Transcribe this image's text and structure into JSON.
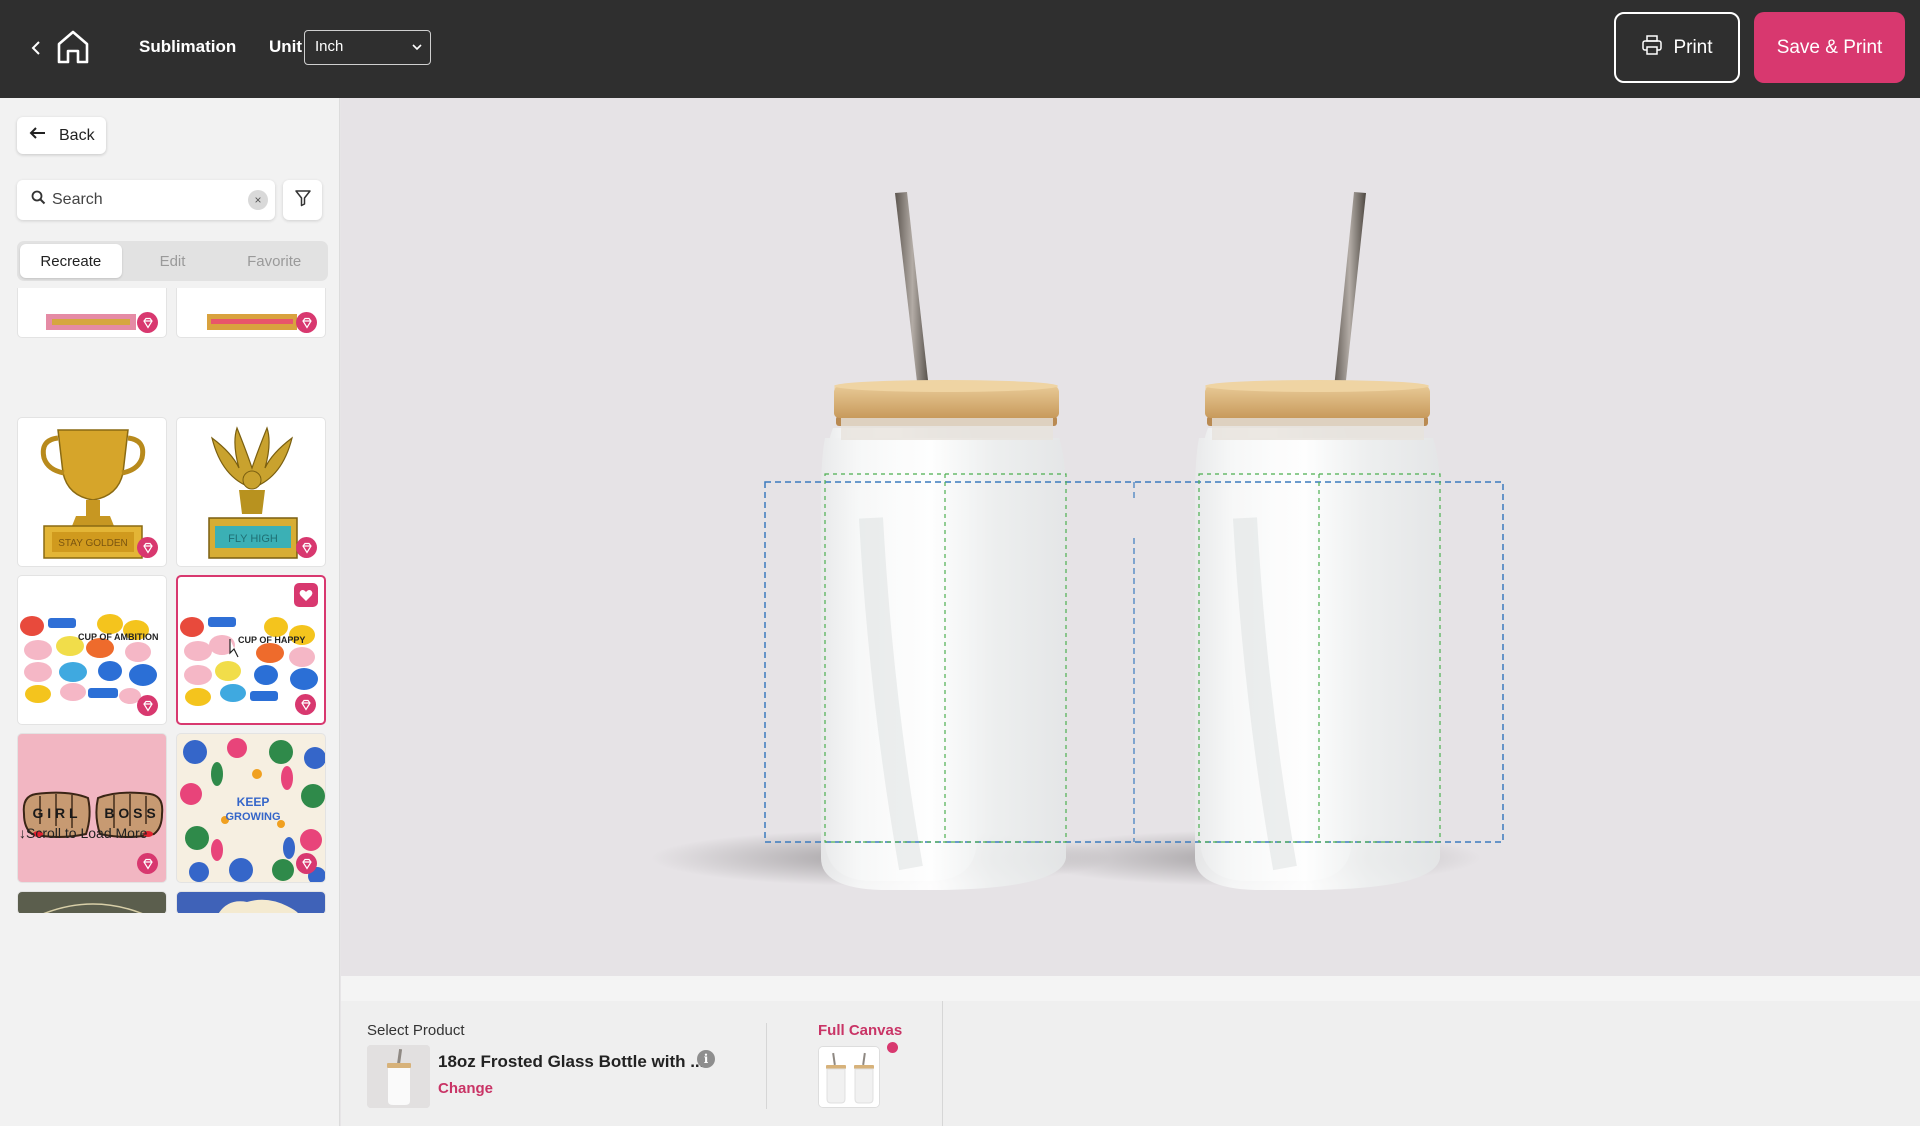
{
  "header": {
    "title": "Sublimation",
    "unit_label": "Unit",
    "unit_value": "Inch",
    "print_label": "Print",
    "save_print_label": "Save & Print"
  },
  "sidebar": {
    "back_label": "Back",
    "search_placeholder": "Search",
    "clear_symbol": "×",
    "tabs": [
      {
        "label": "Recreate",
        "active": true
      },
      {
        "label": "Edit",
        "active": false
      },
      {
        "label": "Favorite",
        "active": false
      }
    ],
    "designs": [
      {
        "name": "stay-golden-trophy",
        "text": "STAY GOLDEN"
      },
      {
        "name": "fly-high-eagle",
        "text": "FLY HIGH"
      },
      {
        "name": "cup-of-ambition-bubbles",
        "text": "CUP OF AMBITION"
      },
      {
        "name": "cup-of-happy-bubbles",
        "text": "CUP OF HAPPY",
        "selected": true,
        "favorited": true
      },
      {
        "name": "girl-boss-fists",
        "text": "GIRL BOSS"
      },
      {
        "name": "keep-growing-florals",
        "text": "KEEP GROWING"
      }
    ],
    "load_more_label": "↓Scroll to Load More"
  },
  "bottom": {
    "select_product_label": "Select Product",
    "product_name": "18oz Frosted Glass Bottle with ...",
    "info_symbol": "i",
    "change_label": "Change",
    "full_canvas_label": "Full Canvas"
  },
  "colors": {
    "accent": "#d8386f",
    "topbar": "#2f2f2f",
    "canvas_bg": "#e6e3e6",
    "guide_blue": "#3b7bbd",
    "guide_green": "#4caf50",
    "bamboo": "#d9b583"
  },
  "icons": [
    "chevron-left-icon",
    "home-icon",
    "chevron-down-icon",
    "printer-icon",
    "arrow-left-icon",
    "search-icon",
    "filter-icon",
    "gem-icon",
    "heart-icon",
    "info-icon"
  ]
}
